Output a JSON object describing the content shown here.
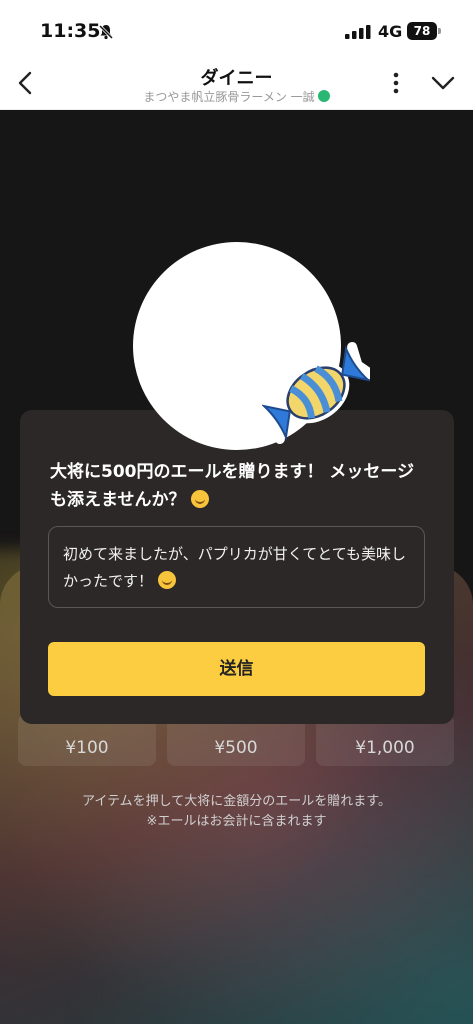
{
  "status_bar": {
    "time": "11:35",
    "network": "4G",
    "battery": "78"
  },
  "nav": {
    "title": "ダイニー",
    "subtitle": "まつやま帆立豚骨ラーメン 一誠"
  },
  "items": [
    {
      "price": "¥100"
    },
    {
      "price": "¥500"
    },
    {
      "price": "¥1,000"
    }
  ],
  "info": {
    "line1": "アイテムを押して大将に金額分のエールを贈れます。",
    "line2": "※エールはお会計に含まれます"
  },
  "dialog": {
    "title": "大将に500円のエールを贈ります！ メッセージも添えませんか？",
    "message": "初めて来ましたが、パプリカが甘くてとても美味しかったです！",
    "send_label": "送信"
  },
  "colors": {
    "accent": "#fccd41",
    "background": "#171616",
    "dialog": "#2b2827"
  }
}
